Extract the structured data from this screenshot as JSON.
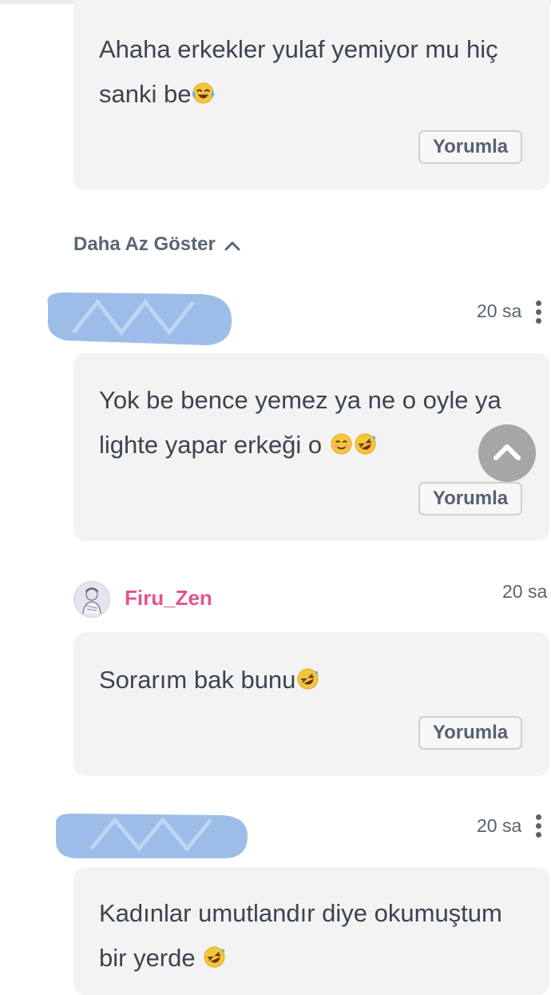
{
  "comments": [
    {
      "text": "Ahaha erkekler yulaf yemiyor mu hiç sanki be",
      "emojis": [
        "face-with-tears-of-joy"
      ],
      "reply_label": "Yorumla"
    },
    {
      "time": "20 sa",
      "text": "Yok be bence yemez ya ne o oyle ya lighte yapar erkeği o ",
      "emojis": [
        "smiling-face-with-smiling-eyes",
        "rolling-on-the-floor-laughing"
      ],
      "reply_label": "Yorumla"
    },
    {
      "username": "Firu_Zen",
      "time": "20 sa",
      "text": "Sorarım bak bunu",
      "emojis": [
        "rolling-on-the-floor-laughing"
      ],
      "reply_label": "Yorumla"
    },
    {
      "time": "20 sa",
      "text": "Kadınlar umutlandır diye okumuştum bir yerde ",
      "emojis": [
        "rolling-on-the-floor-laughing"
      ]
    }
  ],
  "show_less_label": "Daha Az Göster",
  "colors": {
    "card_bg": "#f3f3f3",
    "username": "#e2548f",
    "redaction": "#9dbde8",
    "scroll_button": "#a6a6a6"
  }
}
